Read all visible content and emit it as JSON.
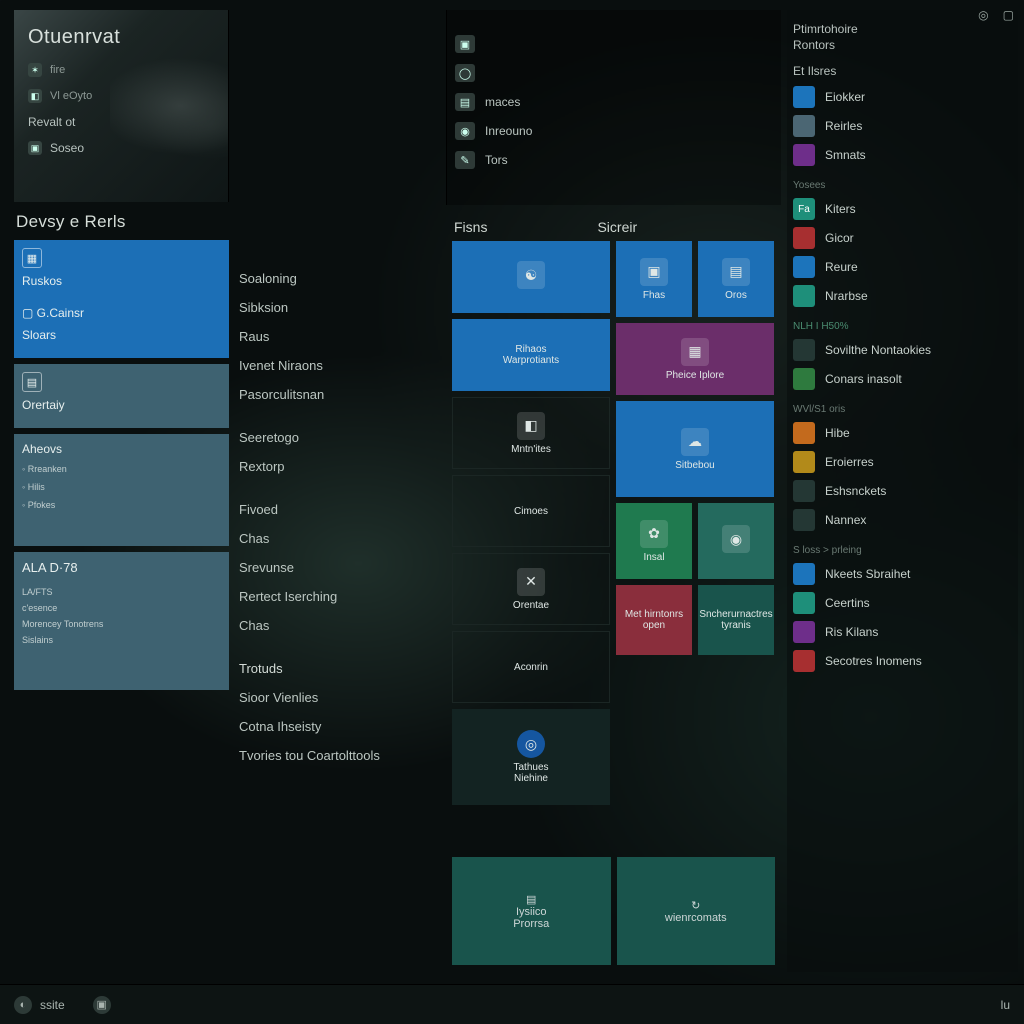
{
  "topright": {
    "wifi": "◎",
    "batt": "▢"
  },
  "hero": {
    "title": "Otuenrvat",
    "items": [
      {
        "icon": "✶",
        "label": "fire",
        "small": true
      },
      {
        "icon": "◧",
        "label": "Vl eOyto",
        "small": true
      },
      {
        "icon": "",
        "label": "Revalt ot"
      },
      {
        "icon": "▣",
        "label": "Soseo"
      }
    ]
  },
  "recent_heading": "Devsy e Rerls",
  "tiles_left": [
    {
      "cls": "tile-blue h1",
      "icon": "▦",
      "label": "Ruskos",
      "sub": "",
      "sub2": "G.Cainsr",
      "sub3": "Sloars"
    },
    {
      "cls": "tile-slate h2",
      "icon": "▤",
      "label": "Orertaiy"
    },
    {
      "cls": "tile-slate h3",
      "label": "Aheovs",
      "extra": [
        "Rreanken",
        "Hilis",
        "Pfokes"
      ]
    },
    {
      "cls": "tile-slate hmed",
      "heading": "ALA D·78",
      "lines": [
        "LA/FTS",
        "c'esence",
        "Morencey Tonotrens",
        "Sislains"
      ]
    }
  ],
  "list_col2": {
    "a": [
      "Soaloning",
      "Sibksion",
      "Raus",
      "Ivenet Niraons",
      "Pasorculitsnan"
    ],
    "b": [
      "Seeretogo",
      "Rextorp"
    ],
    "c": [
      "Fivoed",
      "Chas",
      "Srevunse",
      "Rertect Iserching",
      "Chas"
    ],
    "d_head": "Trotuds",
    "d": [
      "Sioor Vienlies",
      "Cotna Ihseisty",
      "Tvories tou Coartolttools"
    ]
  },
  "col3_quick": [
    {
      "icon": "▣",
      "label": ""
    },
    {
      "icon": "◯",
      "label": ""
    },
    {
      "icon": "▤",
      "label": "maces"
    },
    {
      "icon": "◉",
      "label": "Inreouno"
    },
    {
      "icon": "✎",
      "label": "Tors"
    }
  ],
  "col3_heads": {
    "a": "Fisns",
    "b": "Sicreir"
  },
  "grid_left": [
    {
      "cls": "tile-blue",
      "glyph": "☯",
      "label": ""
    },
    {
      "cls": "tile-blue",
      "glyph": "",
      "label": "Rihaos",
      "sub": "Warprotiants"
    },
    {
      "cls": "tile-dark",
      "glyph": "◧",
      "label": "Mntn'ites"
    },
    {
      "cls": "tile-dark",
      "glyph": "",
      "label": "Cimoes"
    },
    {
      "cls": "tile-dark",
      "glyph": "✕",
      "label": "Orentae"
    },
    {
      "cls": "tile-dark",
      "glyph": "",
      "label": "Aconrin"
    }
  ],
  "grid_right_pair1": [
    {
      "cls": "tile-blue",
      "glyph": "▣",
      "label": "Fhas"
    },
    {
      "cls": "tile-blue",
      "glyph": "▤",
      "label": "Oros"
    }
  ],
  "grid_right_items": [
    {
      "cls": "tile-purple",
      "glyph": "▦",
      "label": "Pheice Iplore"
    },
    {
      "cls": "tile-blue tall",
      "glyph": "☁",
      "label": "Sitbebou"
    }
  ],
  "grid_right_pair2": [
    {
      "cls": "tile-green",
      "glyph": "✿",
      "label": "Insal"
    },
    {
      "cls": "tile-teal",
      "glyph": "◉",
      "label": ""
    }
  ],
  "grid_right_pair3": [
    {
      "cls": "tile-red",
      "label": "Met hirntonrs",
      "sub": "open"
    },
    {
      "cls": "tile-deepteal",
      "label": "Sncherurnactres",
      "sub": "tyranis"
    }
  ],
  "circle_tile": {
    "cls": "tile-nav",
    "glyph": "◎",
    "label": "Tathues",
    "sub": "Niehine"
  },
  "lowpair": [
    {
      "cls": "tile-deepteal",
      "glyph": "▤",
      "label": "Iysiico",
      "sub": "Prorrsa"
    },
    {
      "cls": "tile-deepteal",
      "glyph": "↻",
      "label": "wienrcomats"
    }
  ],
  "right_panel": {
    "head1": "Ptimrtohoire",
    "head1b": "Rontors",
    "sec1_head": "Et Ilsres",
    "sec1": [
      {
        "cls": "blue",
        "label": "Eiokker"
      },
      {
        "cls": "slate",
        "label": "Reirles"
      },
      {
        "cls": "purple",
        "label": "Smnats"
      }
    ],
    "sec2_head": "Yosees",
    "sec2": [
      {
        "cls": "teal",
        "label": "Kiters",
        "pre": "Fa"
      },
      {
        "cls": "red",
        "label": "Gicor"
      },
      {
        "cls": "blue",
        "label": "Reure"
      },
      {
        "cls": "teal",
        "label": "Nrarbse"
      }
    ],
    "sub_hint": "NLH I H50%",
    "sec3": [
      {
        "cls": "dk",
        "label": "Sovilthe Nontaokies"
      },
      {
        "cls": "green",
        "label": "Conars inasolt"
      }
    ],
    "sec4_head": "WVl/S1 oris",
    "sec4": [
      {
        "cls": "orange",
        "label": "Hibe"
      },
      {
        "cls": "gold",
        "label": "Eroierres"
      },
      {
        "cls": "dk",
        "label": "Eshsnckets"
      },
      {
        "cls": "dk",
        "label": "Nannex"
      }
    ],
    "sec5_head": "S loss > prleing",
    "sec5": [
      {
        "cls": "blue",
        "label": "Nkeets Sbraihet"
      },
      {
        "cls": "teal",
        "label": "Ceertins"
      },
      {
        "cls": "purple",
        "label": "Ris Kilans"
      },
      {
        "cls": "red",
        "label": "Secotres Inomens"
      }
    ]
  },
  "taskbar": [
    {
      "icon": "◐",
      "label": "ssite"
    },
    {
      "icon": "▣",
      "label": ""
    }
  ],
  "taskbar_right": "lu"
}
